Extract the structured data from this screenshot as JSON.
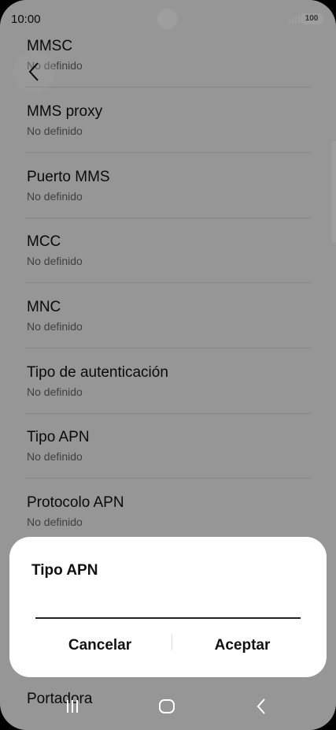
{
  "status_bar": {
    "time": "10:00",
    "battery": "100"
  },
  "settings_items": [
    {
      "title": "MMSC",
      "value": "No definido"
    },
    {
      "title": "MMS proxy",
      "value": "No definido"
    },
    {
      "title": "Puerto MMS",
      "value": "No definido"
    },
    {
      "title": "MCC",
      "value": "No definido"
    },
    {
      "title": "MNC",
      "value": "No definido"
    },
    {
      "title": "Tipo de autenticación",
      "value": "No definido"
    },
    {
      "title": "Tipo APN",
      "value": "No definido"
    },
    {
      "title": "Protocolo APN",
      "value": "No definido"
    },
    {
      "title": "Portadora",
      "value": ""
    }
  ],
  "dialog": {
    "title": "Tipo APN",
    "input_value": "",
    "cancel_label": "Cancelar",
    "accept_label": "Aceptar"
  },
  "icons": [
    "back-arrow-icon",
    "signal-icon",
    "recents-icon",
    "home-icon",
    "nav-back-icon"
  ]
}
